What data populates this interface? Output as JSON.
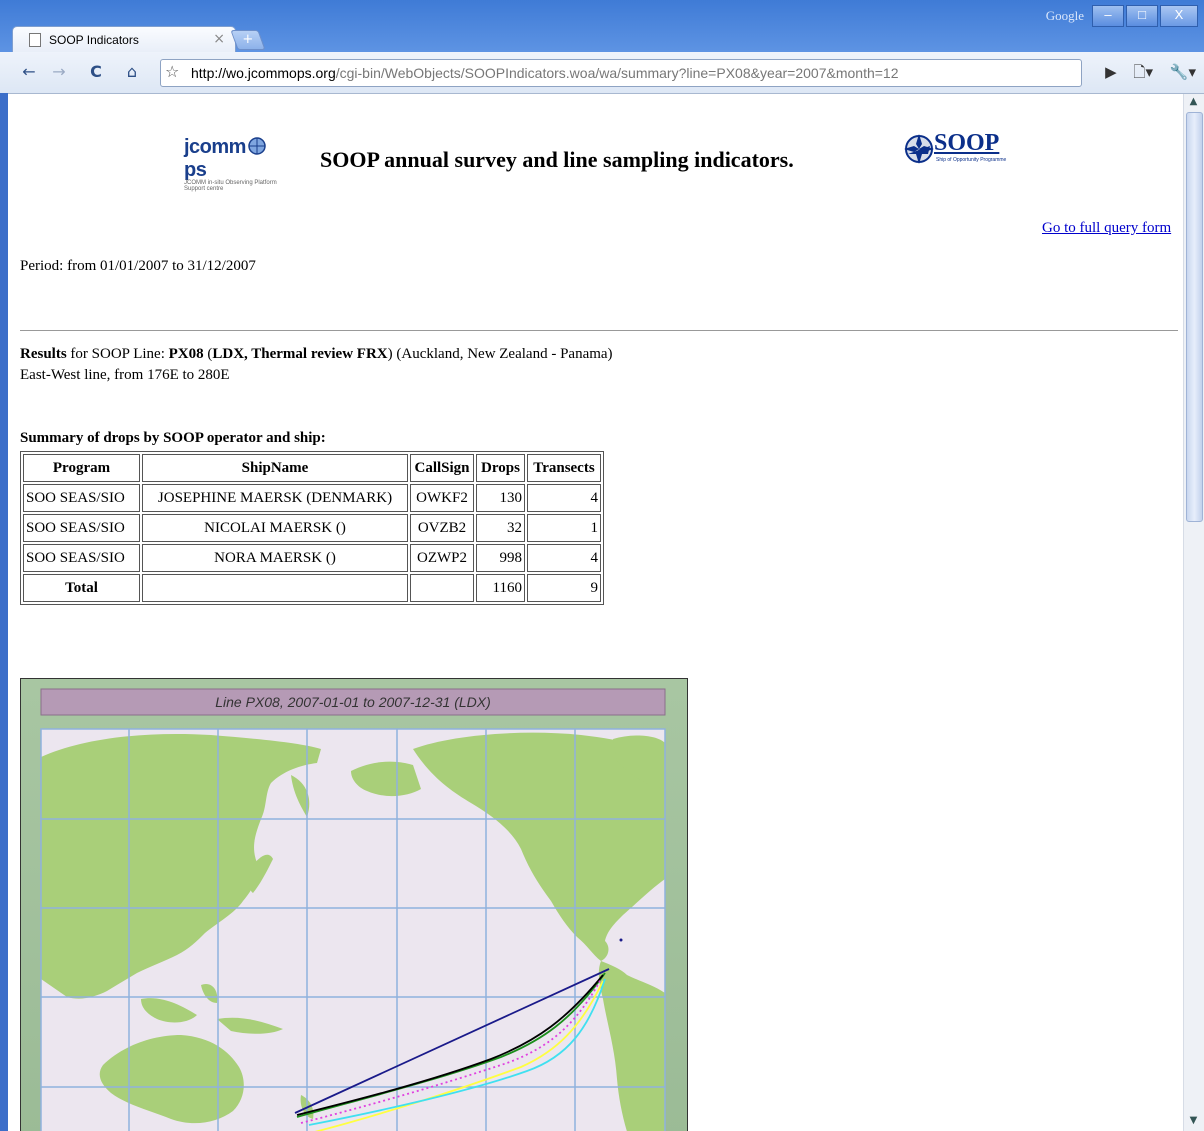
{
  "browser": {
    "brand": "Google",
    "window_buttons": [
      "–",
      "□",
      "X"
    ],
    "tab_title": "SOOP Indicators",
    "tab_close": "×",
    "new_tab": "+",
    "url_host": "http://wo.jcommops.org",
    "url_path": "/cgi-bin/WebObjects/SOOPIndicators.woa/wa/summary?line=PX08&year=2007&month=12",
    "nav": {
      "back": "←",
      "forward": "→",
      "reload": "C",
      "home": "⌂",
      "star": "☆",
      "go": "▶",
      "page_menu": "🗋▾",
      "tools_menu": "🔧▾"
    }
  },
  "header": {
    "jcomm_logo": "jcomm",
    "jcomm_logo_end": "ps",
    "jcomm_logo_sub": "JCOMM in-situ Observing Platform Support centre",
    "title": "SOOP annual survey and line sampling indicators.",
    "soop_logo": "SOOP",
    "soop_logo_sub": "Ship of Opportunity Programme"
  },
  "full_query_link": "Go to full query form",
  "period": "Period: from 01/01/2007 to 31/12/2007",
  "results": {
    "label_bold": "Results",
    "label_rest": " for SOOP Line: ",
    "line": "PX08",
    "paren_open": " (",
    "modes": "LDX, Thermal review FRX",
    "paren_close": ")",
    "route": " (Auckland, New Zealand - Panama)",
    "direction": "East-West line, from 176E to 280E"
  },
  "summary": {
    "title": "Summary of drops by SOOP operator and ship:",
    "columns": [
      "Program",
      "ShipName",
      "CallSign",
      "Drops",
      "Transects"
    ],
    "rows": [
      {
        "program": "SOO SEAS/SIO",
        "ship": "JOSEPHINE MAERSK (DENMARK)",
        "callsign": "OWKF2",
        "drops": "130",
        "transects": "4"
      },
      {
        "program": "SOO SEAS/SIO",
        "ship": "NICOLAI MAERSK ()",
        "callsign": "OVZB2",
        "drops": "32",
        "transects": "1"
      },
      {
        "program": "SOO SEAS/SIO",
        "ship": "NORA MAERSK ()",
        "callsign": "OZWP2",
        "drops": "998",
        "transects": "4"
      }
    ],
    "total": {
      "label": "Total",
      "drops": "1160",
      "transects": "9"
    }
  },
  "map": {
    "title": "Line PX08, 2007-01-01 to 2007-12-31 (LDX)",
    "colors": {
      "ocean": "#ece6ef",
      "land": "#a9cf79",
      "grid": "#8fb2dd",
      "frame": "#a3c1a0",
      "title_bar": "#b59ab5"
    }
  }
}
